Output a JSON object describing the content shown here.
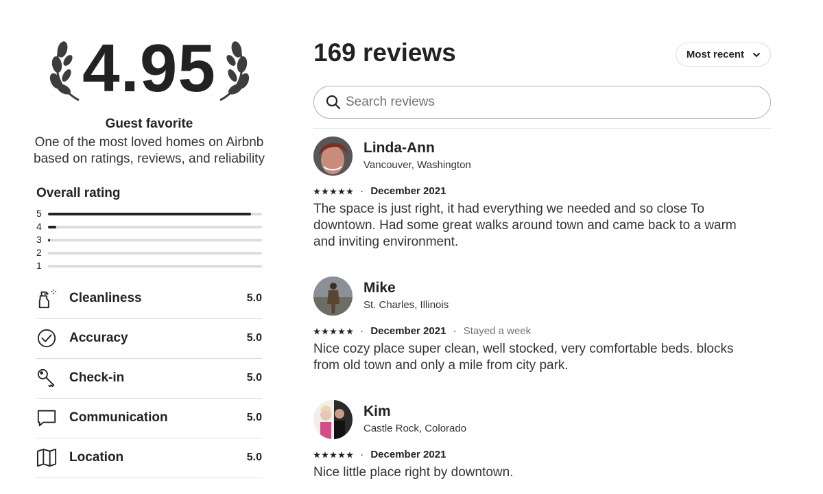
{
  "summary": {
    "score": "4.95",
    "favorite_title": "Guest favorite",
    "favorite_desc": "One of the most loved homes on Airbnb based on ratings, reviews, and reliability",
    "overall_label": "Overall rating",
    "distribution": [
      {
        "label": "5",
        "fraction": 0.95
      },
      {
        "label": "4",
        "fraction": 0.04
      },
      {
        "label": "3",
        "fraction": 0.01
      },
      {
        "label": "2",
        "fraction": 0.0
      },
      {
        "label": "1",
        "fraction": 0.0
      }
    ],
    "categories": [
      {
        "label": "Cleanliness",
        "value": "5.0",
        "icon": "spray-bottle-icon"
      },
      {
        "label": "Accuracy",
        "value": "5.0",
        "icon": "check-circle-icon"
      },
      {
        "label": "Check-in",
        "value": "5.0",
        "icon": "key-icon"
      },
      {
        "label": "Communication",
        "value": "5.0",
        "icon": "chat-bubble-icon"
      },
      {
        "label": "Location",
        "value": "5.0",
        "icon": "map-icon"
      }
    ]
  },
  "reviews_header": {
    "count_label": "169 reviews",
    "sort_label": "Most recent",
    "search_placeholder": "Search reviews"
  },
  "reviews": [
    {
      "name": "Linda-Ann",
      "location": "Vancouver, Washington",
      "date": "December 2021",
      "stay": "",
      "text": "The space is just right, it had everything we needed and so close To downtown. Had some great walks around town and came back to a warm and inviting environment."
    },
    {
      "name": "Mike",
      "location": "St. Charles, Illinois",
      "date": "December 2021",
      "stay": "Stayed a week",
      "text": "Nice cozy place super clean, well stocked, very comfortable beds. blocks from old town and only a mile from city park."
    },
    {
      "name": "Kim",
      "location": "Castle Rock, Colorado",
      "date": "December 2021",
      "stay": "",
      "text": "Nice little place right by downtown."
    }
  ],
  "colors": {
    "text": "#222222",
    "muted": "#717171",
    "border": "#dddddd"
  }
}
